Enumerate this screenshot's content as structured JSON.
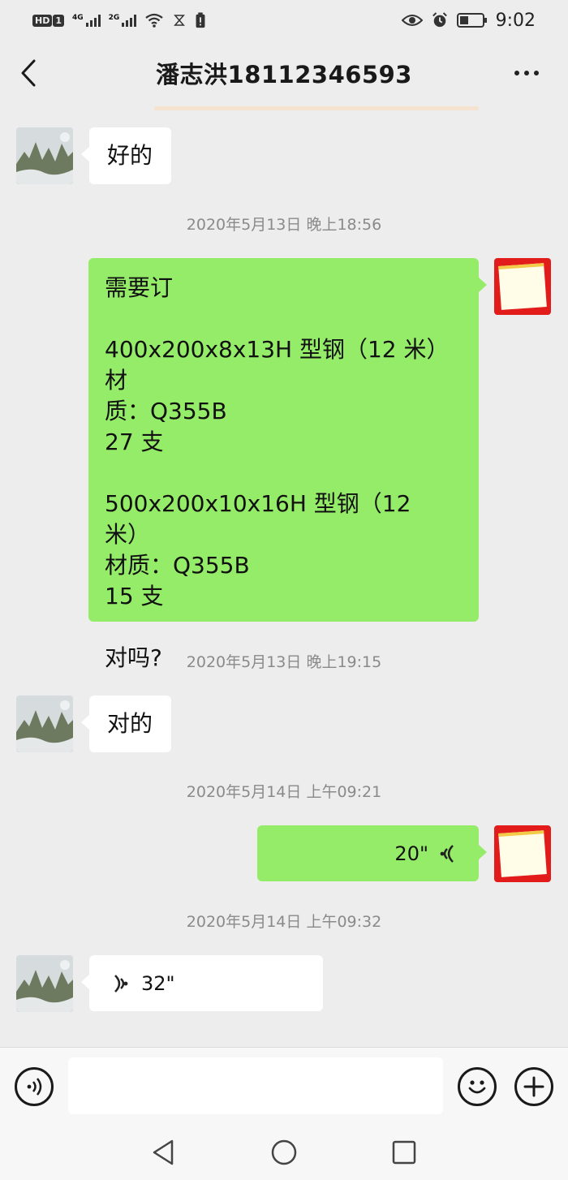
{
  "status_bar": {
    "hd": "HD",
    "sim": "1",
    "net1": "4G",
    "net2": "2G",
    "time": "9:02"
  },
  "header": {
    "title": "潘志洪18112346593"
  },
  "messages": [
    {
      "side": "left",
      "kind": "text",
      "text": "好的"
    },
    {
      "kind": "timestamp",
      "text": "2020年5月13日 晚上18:56"
    },
    {
      "side": "right",
      "kind": "text",
      "text": "需要订\n\n400x200x8x13H 型钢（12 米）材\n质：Q355B\n27 支\n\n500x200x10x16H 型钢（12 米）\n材质：Q355B\n15 支\n\n对吗?"
    },
    {
      "kind": "timestamp",
      "text": "2020年5月13日 晚上19:15"
    },
    {
      "side": "left",
      "kind": "text",
      "text": "对的"
    },
    {
      "kind": "timestamp",
      "text": "2020年5月14日 上午09:21"
    },
    {
      "side": "right",
      "kind": "voice",
      "duration": "20\""
    },
    {
      "kind": "timestamp",
      "text": "2020年5月14日 上午09:32"
    },
    {
      "side": "left",
      "kind": "voice",
      "duration": "32\""
    }
  ],
  "input": {
    "value": "",
    "placeholder": ""
  },
  "icons": {
    "back": "chevron-left-icon",
    "more": "more-dots-icon",
    "voice_toggle": "voice-icon",
    "emoji": "emoji-icon",
    "add": "plus-icon",
    "nav_back": "triangle-back-icon",
    "nav_home": "circle-home-icon",
    "nav_recent": "square-recent-icon"
  },
  "colors": {
    "bubble_right": "#95ec69",
    "bubble_left": "#ffffff",
    "background": "#ededed"
  }
}
